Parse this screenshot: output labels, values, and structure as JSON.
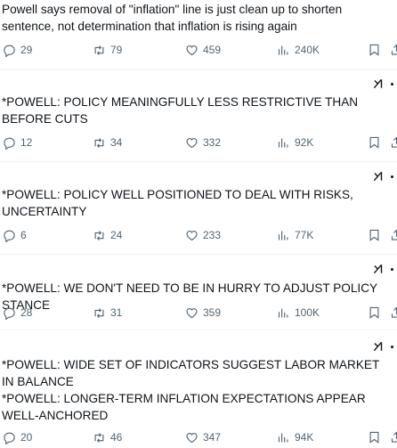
{
  "posts": [
    {
      "text": "Powell says removal of \"inflation\" line is just clean up to shorten sentence, not determination that inflation is rising again",
      "replies": "29",
      "reposts": "79",
      "likes": "459",
      "views": "240K"
    },
    {
      "text": "*POWELL: POLICY MEANINGFULLY LESS RESTRICTIVE THAN BEFORE CUTS",
      "replies": "12",
      "reposts": "34",
      "likes": "332",
      "views": "92K"
    },
    {
      "text": "*POWELL: POLICY WELL POSITIONED TO DEAL WITH RISKS, UNCERTAINTY",
      "replies": "6",
      "reposts": "24",
      "likes": "233",
      "views": "77K"
    },
    {
      "text": "*POWELL: WE DON'T NEED TO BE IN HURRY TO ADJUST POLICY STANCE",
      "replies": "28",
      "reposts": "31",
      "likes": "359",
      "views": "100K"
    },
    {
      "text": "*POWELL: WIDE SET OF INDICATORS SUGGEST LABOR MARKET IN BALANCE\n*POWELL: LONGER-TERM INFLATION EXPECTATIONS APPEAR WELL-ANCHORED",
      "replies": "20",
      "reposts": "46",
      "likes": "347",
      "views": "94K"
    }
  ],
  "icons": {
    "reply": "reply-icon",
    "repost": "repost-icon",
    "like": "like-icon",
    "views": "views-icon",
    "bookmark": "bookmark-icon",
    "share": "share-icon",
    "grok": "grok-icon",
    "more": "more-icon"
  },
  "colors": {
    "text": "#0f1419",
    "secondary": "#536471",
    "divider": "#eff3f4"
  }
}
